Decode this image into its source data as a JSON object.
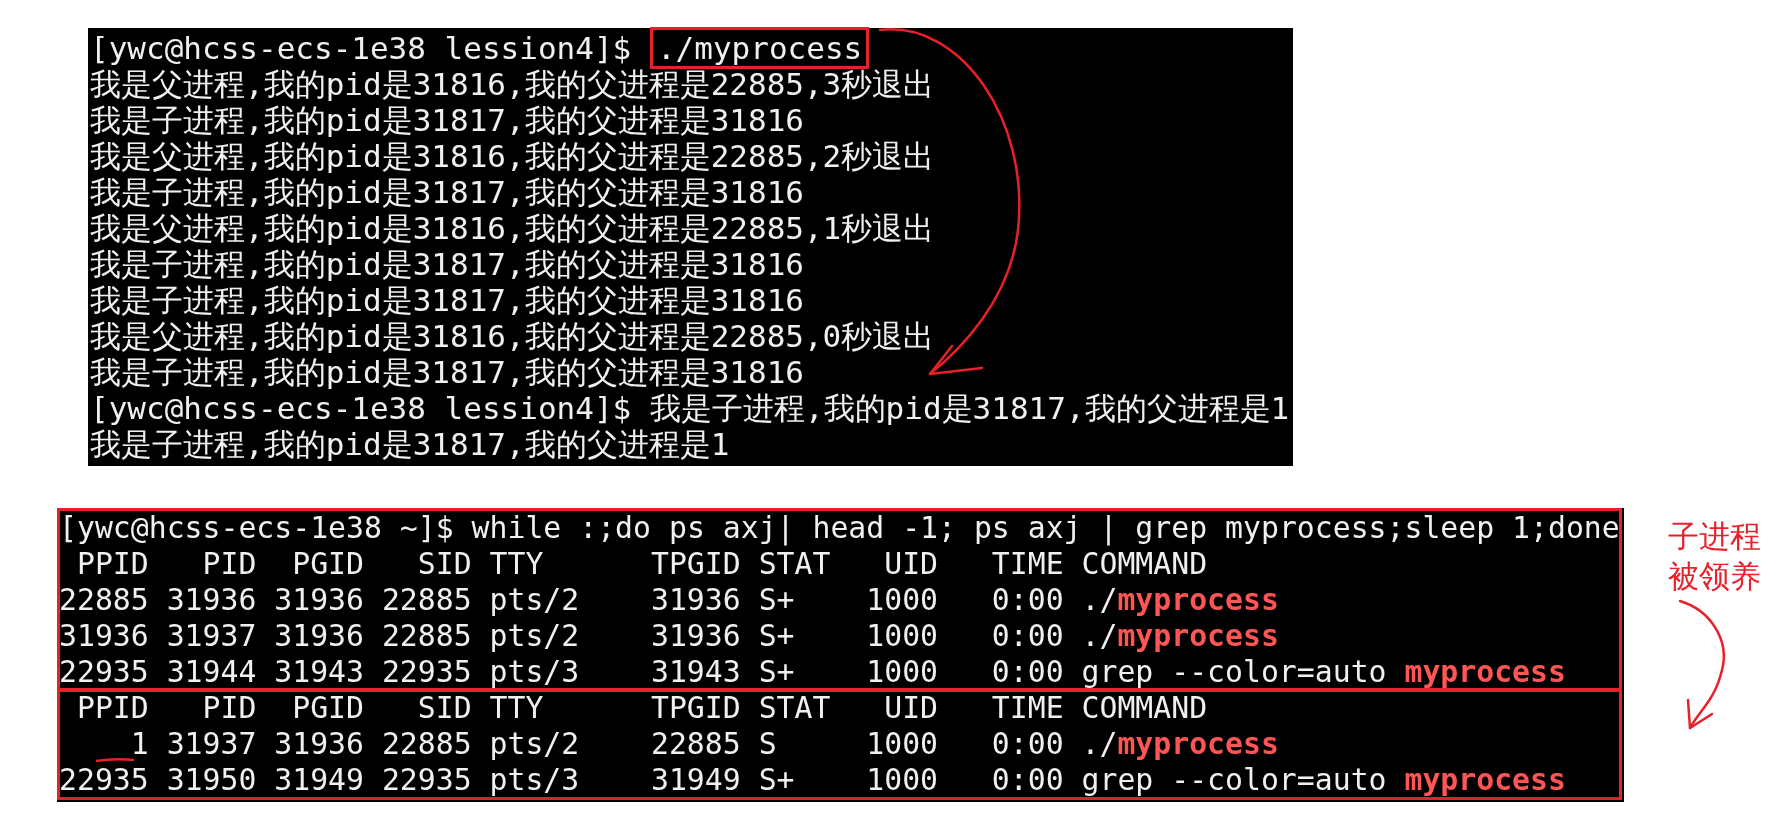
{
  "top_terminal": {
    "lines": [
      {
        "kind": "command",
        "prompt": "[ywc@hcss-ecs-1e38 lession4]$ ",
        "input": "./myprocess",
        "boxed": true
      },
      {
        "kind": "output",
        "text": "我是父进程,我的pid是31816,我的父进程是22885,3秒退出"
      },
      {
        "kind": "output",
        "text": "我是子进程,我的pid是31817,我的父进程是31816"
      },
      {
        "kind": "output",
        "text": "我是父进程,我的pid是31816,我的父进程是22885,2秒退出"
      },
      {
        "kind": "output",
        "text": "我是子进程,我的pid是31817,我的父进程是31816"
      },
      {
        "kind": "output",
        "text": "我是父进程,我的pid是31816,我的父进程是22885,1秒退出"
      },
      {
        "kind": "output",
        "text": "我是子进程,我的pid是31817,我的父进程是31816"
      },
      {
        "kind": "output",
        "text": "我是子进程,我的pid是31817,我的父进程是31816"
      },
      {
        "kind": "output",
        "text": "我是父进程,我的pid是31816,我的父进程是22885,0秒退出"
      },
      {
        "kind": "output",
        "text": "我是子进程,我的pid是31817,我的父进程是31816"
      },
      {
        "kind": "command",
        "prompt": "[ywc@hcss-ecs-1e38 lession4]$ ",
        "input": "我是子进程,我的pid是31817,我的父进程是1"
      },
      {
        "kind": "output",
        "text": "我是子进程,我的pid是31817,我的父进程是1"
      }
    ]
  },
  "bottom_terminal": {
    "groups": [
      {
        "boxed": true,
        "lines": [
          {
            "kind": "command",
            "prompt": "[ywc@hcss-ecs-1e38 ~]$ ",
            "input": "while :;do ps axj| head -1; ps axj | grep myprocess;sleep 1;done"
          },
          {
            "kind": "output",
            "text": " PPID   PID  PGID   SID TTY      TPGID STAT   UID   TIME COMMAND"
          },
          {
            "kind": "output",
            "text": "22885 31936 31936 22885 pts/2    31936 S+    1000   0:00 ./",
            "match": "myprocess"
          },
          {
            "kind": "output",
            "text": "31936 31937 31936 22885 pts/2    31936 S+    1000   0:00 ./",
            "match": "myprocess"
          },
          {
            "kind": "output",
            "text": "22935 31944 31943 22935 pts/3    31943 S+    1000   0:00 grep --color=auto ",
            "match": "myprocess"
          }
        ]
      },
      {
        "boxed": true,
        "lines": [
          {
            "kind": "output",
            "text": " PPID   PID  PGID   SID TTY      TPGID STAT   UID   TIME COMMAND"
          },
          {
            "kind": "output",
            "text": "    1 31937 31936 22885 pts/2    22885 S     1000   0:00 ./",
            "match": "myprocess",
            "underlined": true
          },
          {
            "kind": "output",
            "text": "22935 31950 31949 22935 pts/3    31949 S+    1000   0:00 grep --color=auto ",
            "match": "myprocess"
          }
        ]
      }
    ]
  },
  "annotation": {
    "label": "子进程被领养"
  }
}
